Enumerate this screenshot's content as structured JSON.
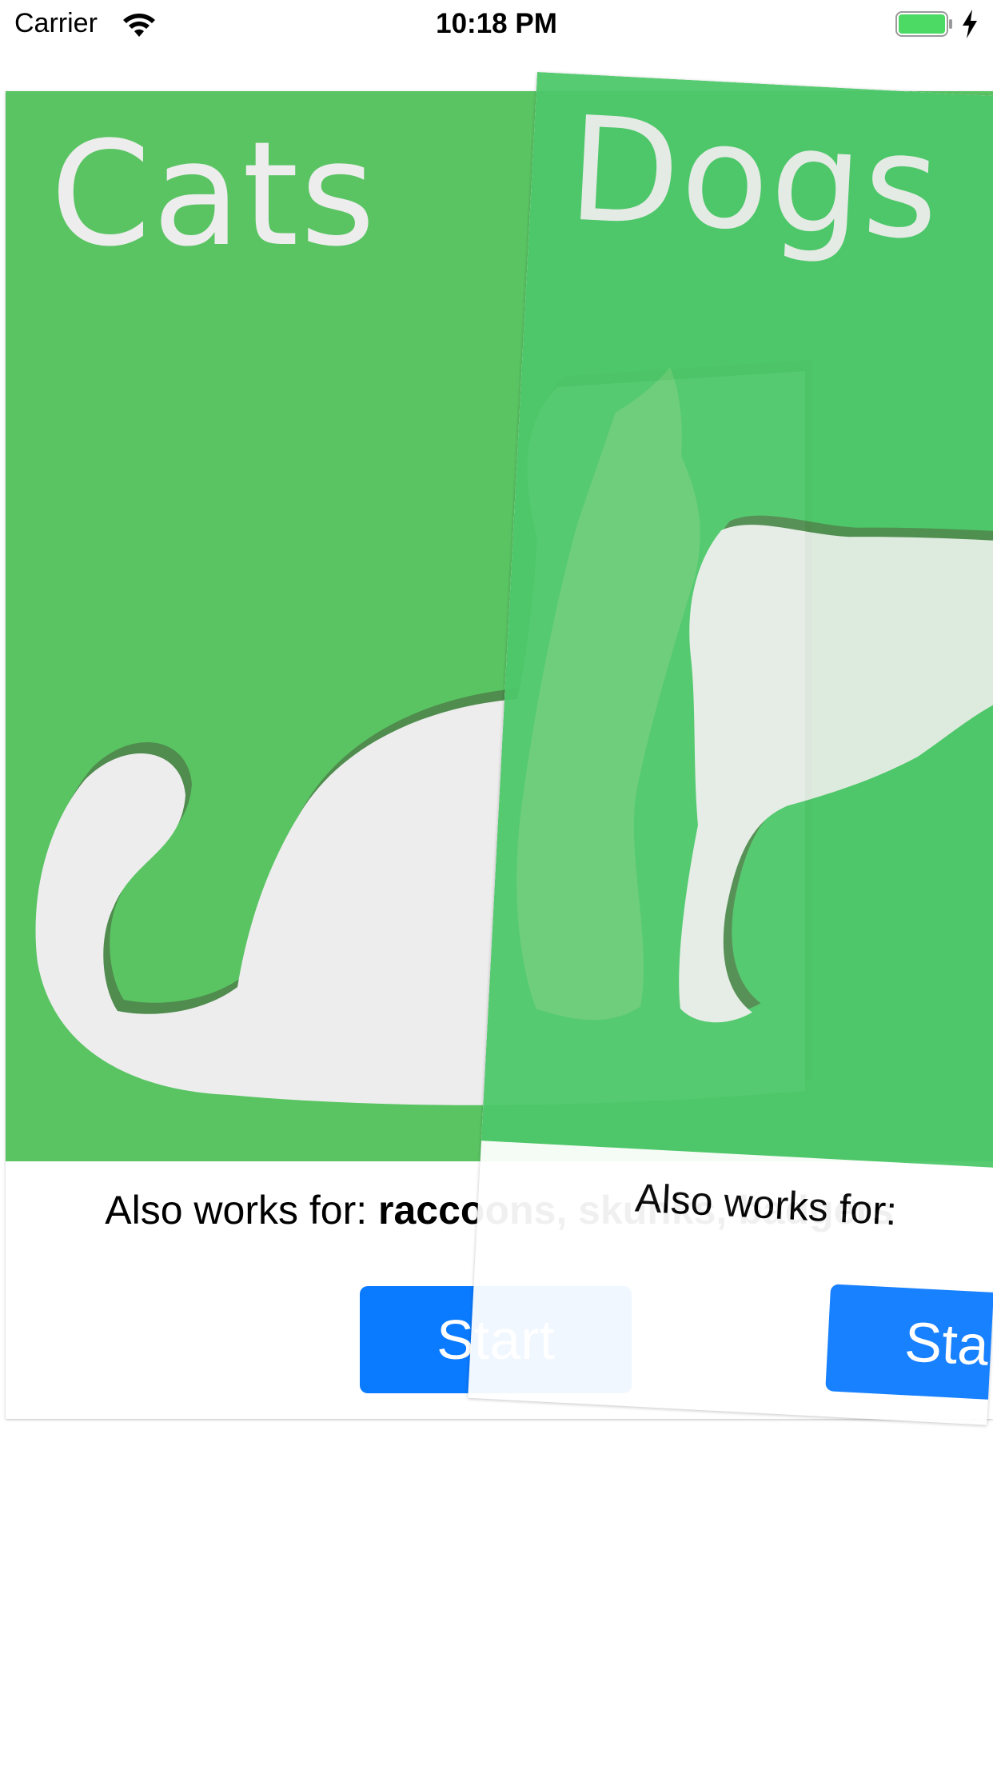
{
  "status_bar": {
    "carrier": "Carrier",
    "time": "10:18 PM",
    "battery_color": "#4cd964"
  },
  "cards": {
    "cats": {
      "title": "Cats",
      "also_prefix": "Also works for: ",
      "also_list": "raccoons, skunks, badgers",
      "button_label": "Start"
    },
    "dogs": {
      "title": "Dogs",
      "also_prefix": "Also works for: ",
      "button_label": "Start"
    }
  },
  "colors": {
    "card_green": "#5ac463",
    "button_blue": "#0a7aff",
    "silhouette": "#ededed"
  }
}
